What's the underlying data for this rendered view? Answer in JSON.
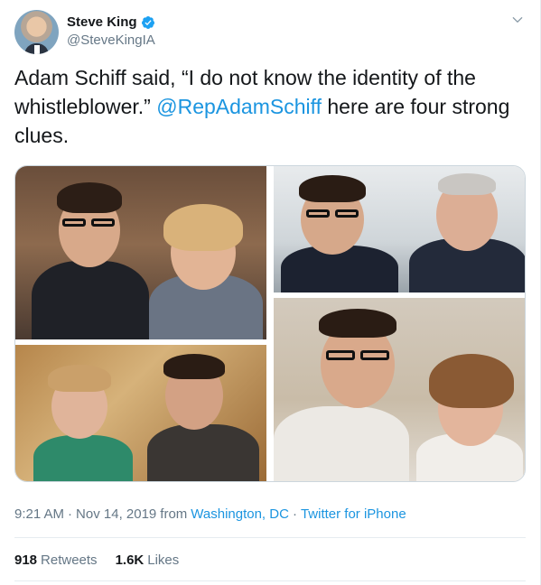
{
  "author": {
    "display_name": "Steve King",
    "handle": "@SteveKingIA",
    "verified": true,
    "avatar_icon": "profile-photo"
  },
  "tweet": {
    "text_before": "Adam Schiff said, “I do not know the identity of the whistleblower.” ",
    "mention": "@RepAdamSchiff",
    "text_after": " here are four strong clues."
  },
  "meta": {
    "time": "9:21 AM",
    "separator1": "·",
    "date": "Nov 14, 2019",
    "from_label": "from",
    "location": "Washington, DC",
    "separator2": "·",
    "source": "Twitter for iPhone"
  },
  "stats": {
    "retweets_count": "918",
    "retweets_label": "Retweets",
    "likes_count": "1.6K",
    "likes_label": "Likes"
  },
  "colors": {
    "link": "#1b95e0",
    "verified_badge": "#1da1f2",
    "secondary_text": "#657786"
  },
  "icons": [
    "verified-badge-icon",
    "chevron-down-icon"
  ]
}
